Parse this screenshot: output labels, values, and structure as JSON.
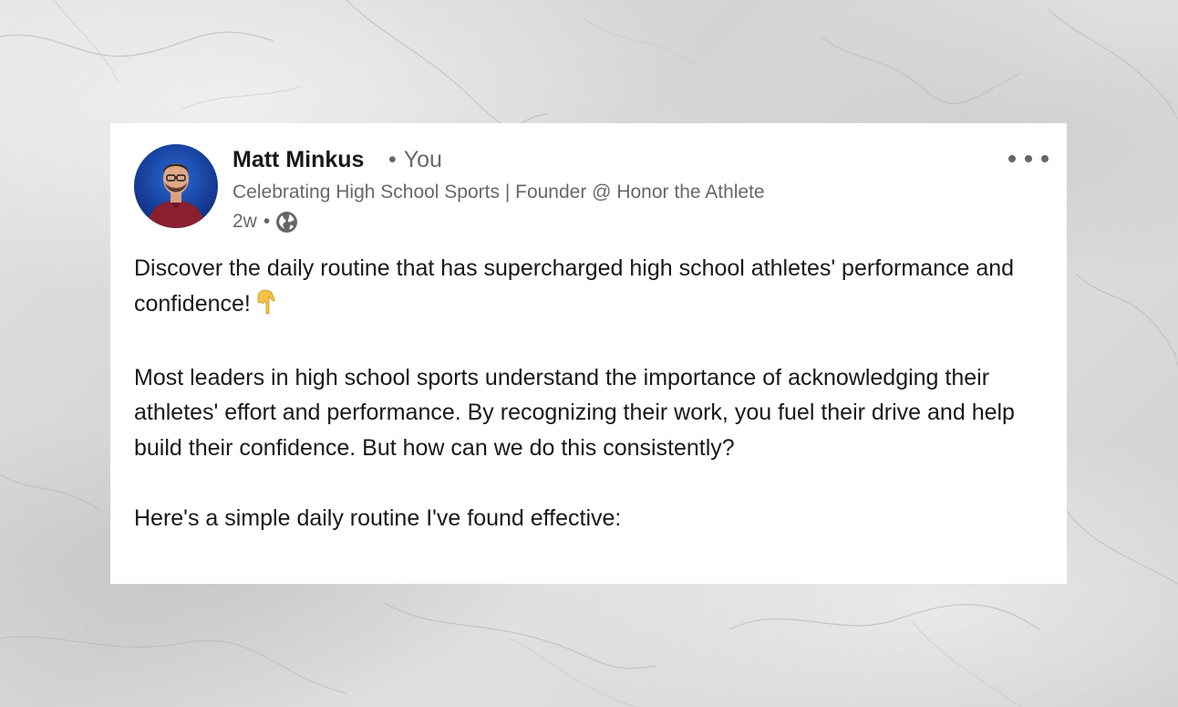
{
  "post": {
    "author": {
      "name": "Matt Minkus",
      "relation": "You",
      "headline": "Celebrating High School Sports | Founder @ Honor the Athlete",
      "time": "2w",
      "visibility_icon": "globe-icon",
      "avatar_icon": "profile-photo"
    },
    "more_icon": "ellipsis-icon",
    "paragraphs": [
      "Discover the daily routine that has supercharged high school athletes' performance and confidence!",
      "Most leaders in high school sports understand the importance of acknowledging their athletes' effort and performance. By recognizing their work, you fuel their drive and help build their confidence. But how can we do this consistently?",
      "Here's a simple daily routine I've found effective:"
    ],
    "emoji_icon": "pointing-down-icon"
  },
  "colors": {
    "card_background": "#ffffff",
    "text_primary": "#191919",
    "text_secondary": "#666666",
    "page_background": "#dcdcdc"
  }
}
